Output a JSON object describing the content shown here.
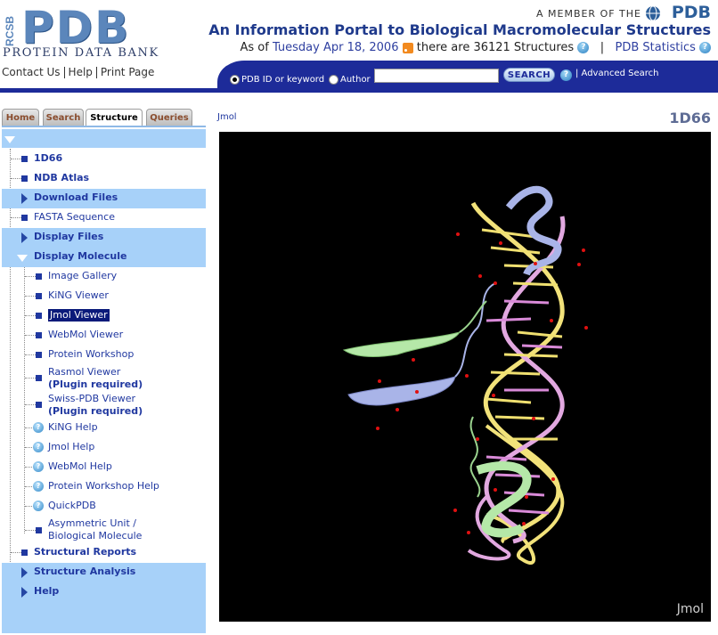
{
  "header": {
    "logo_side": "RCSB",
    "logo_main": "PDB",
    "logo_sub": "PROTEIN DATA BANK",
    "member_text": "A MEMBER OF THE",
    "member_logo": "PDB",
    "tagline": "An Information Portal to Biological Macromolecular Structures",
    "status_prefix": "As of",
    "status_date": "Tuesday Apr 18, 2006",
    "status_count": "there are 36121 Structures",
    "status_sep": "|",
    "stats_link": "PDB Statistics",
    "links": [
      "Contact Us",
      "Help",
      "Print Page"
    ]
  },
  "search": {
    "option1": "PDB ID or keyword",
    "option2": "Author",
    "selected": "PDB ID or keyword",
    "query_value": "",
    "button": "SEARCH",
    "advanced": "| Advanced Search"
  },
  "tabs": [
    {
      "label": "Home",
      "active": false
    },
    {
      "label": "Search",
      "active": false
    },
    {
      "label": "Structure",
      "active": true
    },
    {
      "label": "Queries",
      "active": false
    }
  ],
  "sidebar": {
    "id": "1D66",
    "ndb": "NDB Atlas",
    "download": "Download Files",
    "fasta": "FASTA Sequence",
    "display_files": "Display Files",
    "display_molecule": "Display Molecule",
    "mol_items": [
      "Image Gallery",
      "KiNG Viewer",
      "Jmol Viewer",
      "WebMol Viewer",
      "Protein Workshop"
    ],
    "rasmol": "Rasmol Viewer",
    "rasmol_note": "(Plugin required)",
    "swiss": "Swiss-PDB Viewer",
    "swiss_note": "(Plugin required)",
    "help_items": [
      "KiNG Help",
      "Jmol Help",
      "WebMol Help",
      "Protein Workshop Help",
      "QuickPDB"
    ],
    "asym1": "Asymmetric Unit /",
    "asym2": "Biological Molecule",
    "structural_reports": "Structural Reports",
    "structure_analysis": "Structure Analysis",
    "help": "Help",
    "selected_item": "Jmol Viewer"
  },
  "main": {
    "viewer_label": "Jmol",
    "pdb_id": "1D66",
    "watermark": "Jmol"
  },
  "colors": {
    "nav_blue": "#1d2b99",
    "section_blue": "#a7d1f9",
    "link_blue": "#2038a0",
    "dna_yellow": "#f2e27a",
    "dna_pink": "#e2a8e0",
    "helix_green": "#b5e8a8",
    "helix_lavender": "#a9b4e8"
  }
}
